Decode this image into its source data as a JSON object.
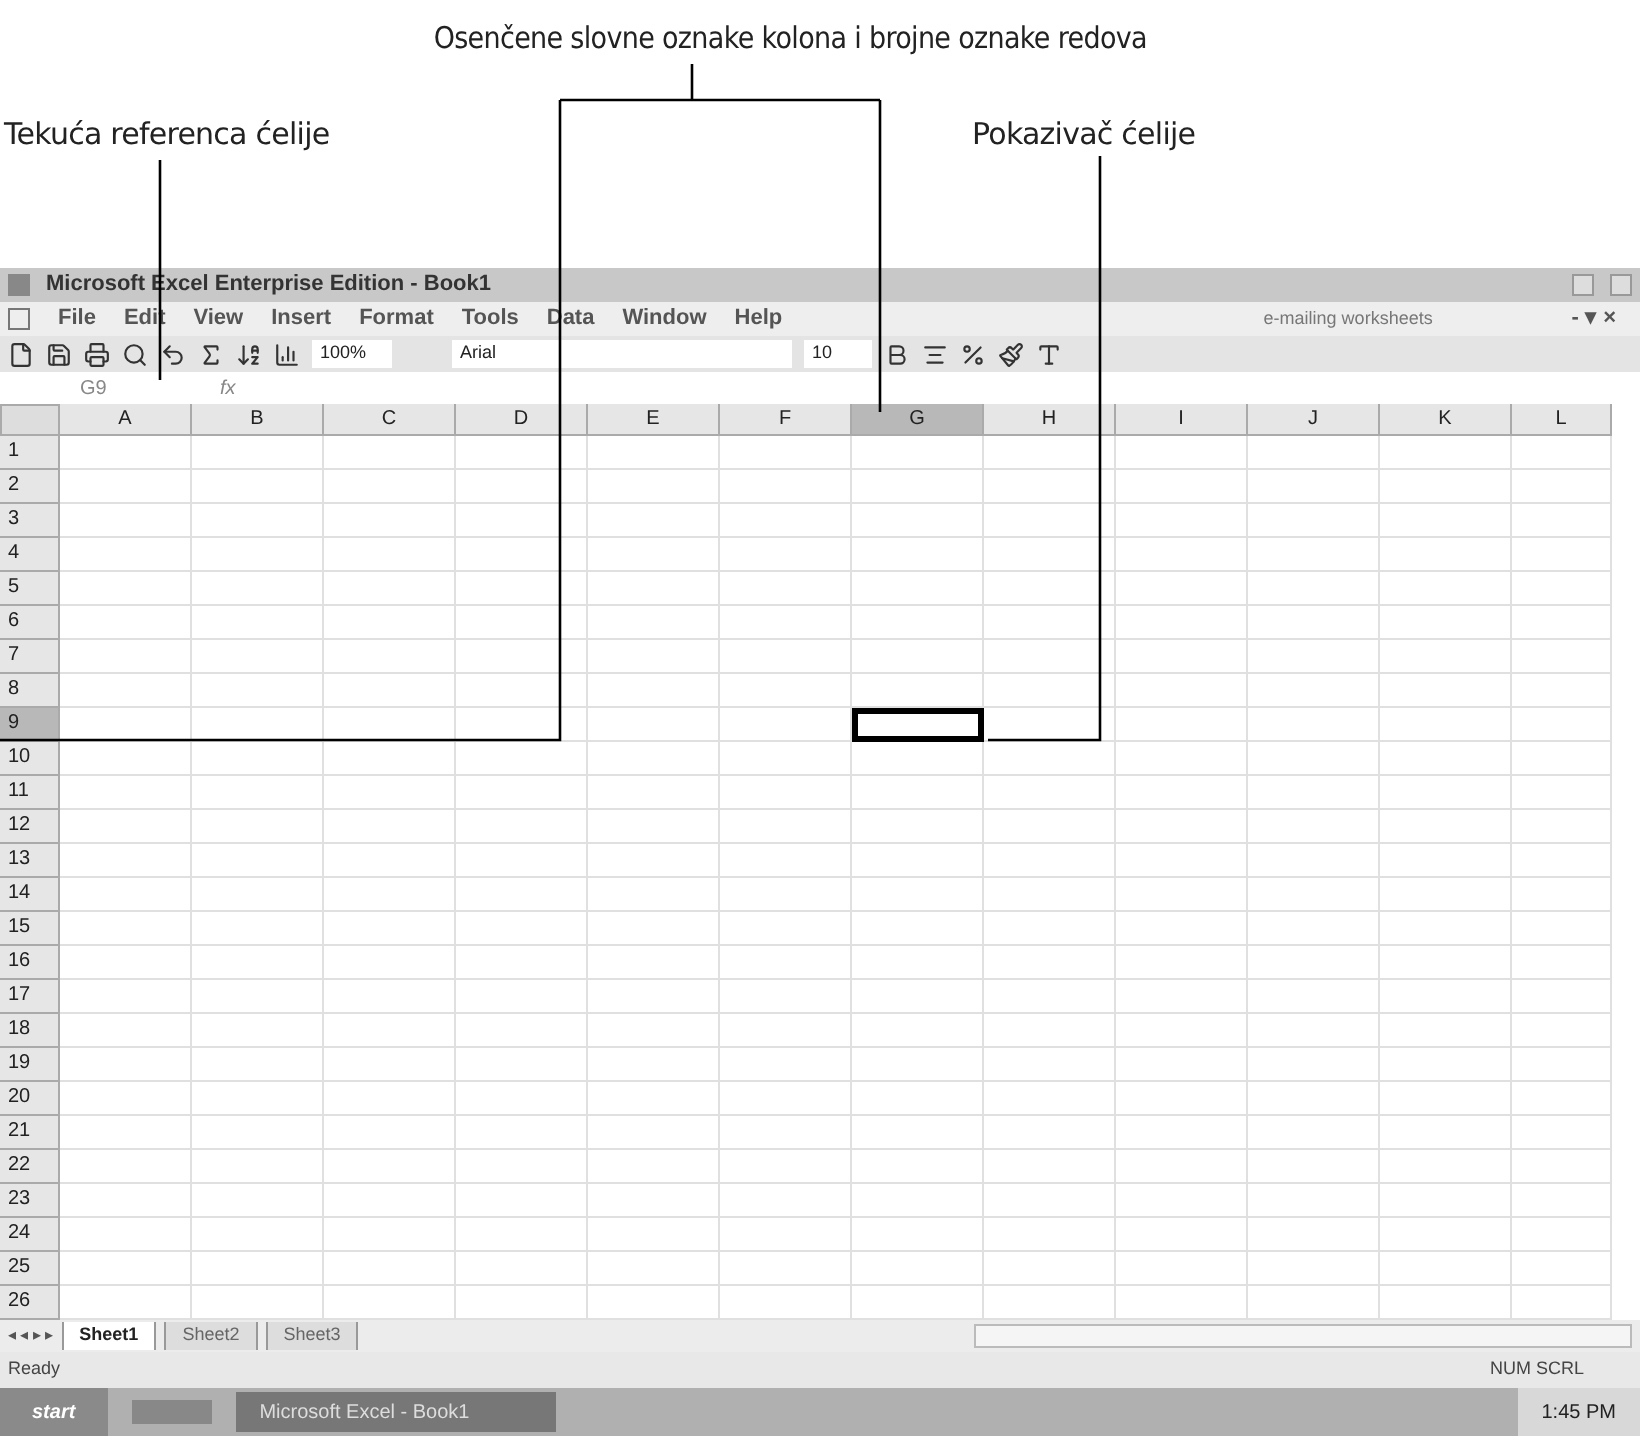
{
  "callouts": [
    {
      "text": "Osenčene slovne oznake kolona i brojne oznake redova"
    },
    {
      "text": "Tekuća referenca ćelije"
    },
    {
      "text": "Pokazivač ćelije"
    }
  ],
  "window": {
    "title": "Microsoft Excel Enterprise Edition - Book1"
  },
  "menu": [
    "File",
    "Edit",
    "View",
    "Insert",
    "Format",
    "Tools",
    "Data",
    "Window",
    "Help"
  ],
  "help_box": {
    "placeholder": "e-mailing worksheets"
  },
  "toolbar": {
    "zoom": "100%",
    "font": "Arial",
    "size": "10"
  },
  "formula_bar": {
    "name_box": "G9",
    "fx": "fx"
  },
  "columns": [
    {
      "label": "A",
      "selected": false
    },
    {
      "label": "B",
      "selected": false
    },
    {
      "label": "C",
      "selected": false
    },
    {
      "label": "D",
      "selected": false
    },
    {
      "label": "E",
      "selected": false
    },
    {
      "label": "F",
      "selected": false
    },
    {
      "label": "G",
      "selected": true
    },
    {
      "label": "H",
      "selected": false
    },
    {
      "label": "I",
      "selected": false
    },
    {
      "label": "J",
      "selected": false
    },
    {
      "label": "K",
      "selected": false
    },
    {
      "label": "L",
      "selected": false
    }
  ],
  "rows": [
    {
      "label": "1",
      "selected": false
    },
    {
      "label": "2",
      "selected": false
    },
    {
      "label": "3",
      "selected": false
    },
    {
      "label": "4",
      "selected": false
    },
    {
      "label": "5",
      "selected": false
    },
    {
      "label": "6",
      "selected": false
    },
    {
      "label": "7",
      "selected": false
    },
    {
      "label": "8",
      "selected": false
    },
    {
      "label": "9",
      "selected": true
    },
    {
      "label": "10",
      "selected": false
    },
    {
      "label": "11",
      "selected": false
    },
    {
      "label": "12",
      "selected": false
    },
    {
      "label": "13",
      "selected": false
    },
    {
      "label": "14",
      "selected": false
    },
    {
      "label": "15",
      "selected": false
    },
    {
      "label": "16",
      "selected": false
    },
    {
      "label": "17",
      "selected": false
    },
    {
      "label": "18",
      "selected": false
    },
    {
      "label": "19",
      "selected": false
    },
    {
      "label": "20",
      "selected": false
    },
    {
      "label": "21",
      "selected": false
    },
    {
      "label": "22",
      "selected": false
    },
    {
      "label": "23",
      "selected": false
    },
    {
      "label": "24",
      "selected": false
    },
    {
      "label": "25",
      "selected": false
    },
    {
      "label": "26",
      "selected": false
    }
  ],
  "window_controls": "- ▾ ×",
  "tab_scroll": "◂ ◂ ▸ ▸",
  "sheet_tabs": [
    {
      "label": "Sheet1",
      "selected": true
    },
    {
      "label": "Sheet2",
      "selected": false
    },
    {
      "label": "Sheet3",
      "selected": false
    }
  ],
  "status_bar": {
    "left": "Ready",
    "right": "NUM SCRL"
  },
  "taskbar": {
    "start": "start",
    "task": "Microsoft Excel - Book1",
    "time": "1:45 PM"
  }
}
